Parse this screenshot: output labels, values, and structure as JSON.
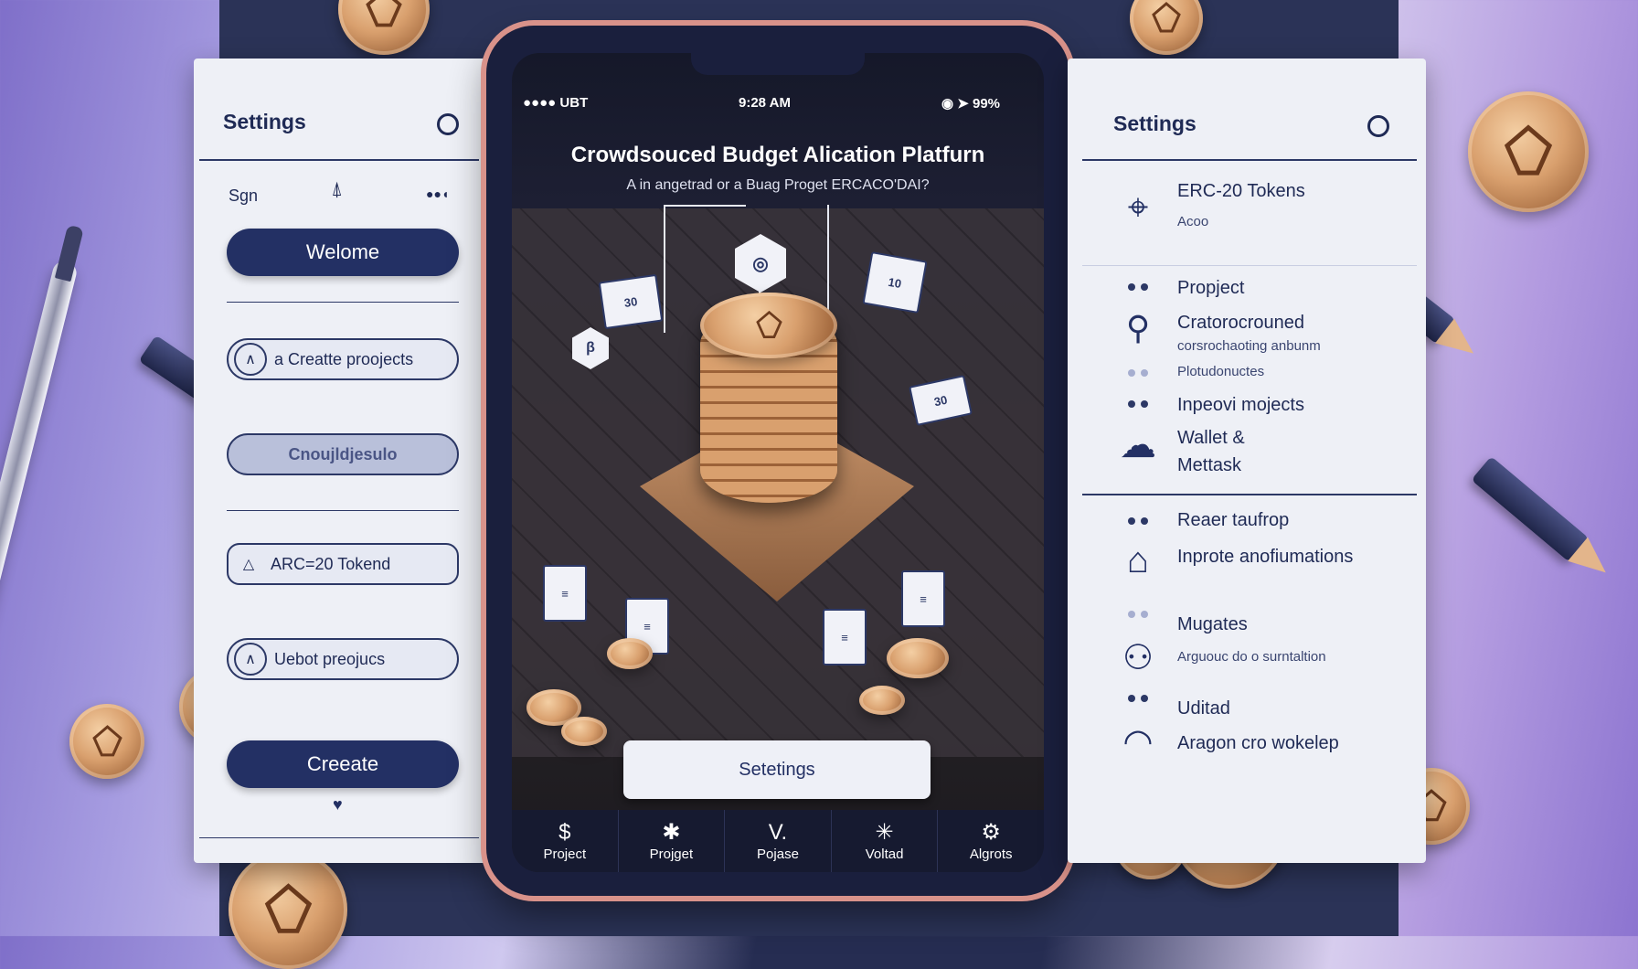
{
  "left_panel": {
    "title": "Settings",
    "sign_label": "Sgn",
    "dots_label": "●●◖",
    "welcome_button": "Welome",
    "create_projects": "a Creatte proojects",
    "blurred_button": "Cnoujldjesulo",
    "token_pill": "ARC=20 Tokend",
    "update_pill": "Uebot preojucs",
    "create_button": "Creeate"
  },
  "phone": {
    "status_left": "●●●● UBT",
    "status_time": "9:28 AM",
    "status_right": "◉ ➤ 99%",
    "title": "Crowdsouced Budget Alication Platfurn",
    "subtitle": "A in angetrad or a Buag Proget ERCACO'DAI?",
    "card_labels": [
      "30",
      "10",
      "30"
    ],
    "settings_button": "Setetings",
    "tabs": [
      {
        "icon": "$",
        "label": "Project"
      },
      {
        "icon": "✱",
        "label": "Projget"
      },
      {
        "icon": "V.",
        "label": "Pojase"
      },
      {
        "icon": "✳",
        "label": "Voltad"
      },
      {
        "icon": "⚙",
        "label": "Algrots"
      }
    ]
  },
  "right_panel": {
    "title": "Settings",
    "token_title": "ERC-20 Tokens",
    "token_sub": "Acoo",
    "items": [
      {
        "title": "Propject"
      },
      {
        "title": "Cratorocrouned",
        "sub": "corsrochaoting anbunm"
      },
      {
        "title": "Plotudonuctes"
      },
      {
        "title": "Inpeovi mojects"
      },
      {
        "title": "Wallet &"
      },
      {
        "title": "Mettask"
      },
      {
        "title": "Reaer taufrop"
      },
      {
        "title": "Inprote anofiumations"
      },
      {
        "title": "Mugates"
      },
      {
        "title": "Arguouc do o surntaltion"
      },
      {
        "title": "Uditad"
      },
      {
        "title": "Aragon cro wokelep"
      }
    ]
  },
  "colors": {
    "navy": "#233064",
    "copper": "#d9a06e",
    "panel": "#eef0f6"
  }
}
